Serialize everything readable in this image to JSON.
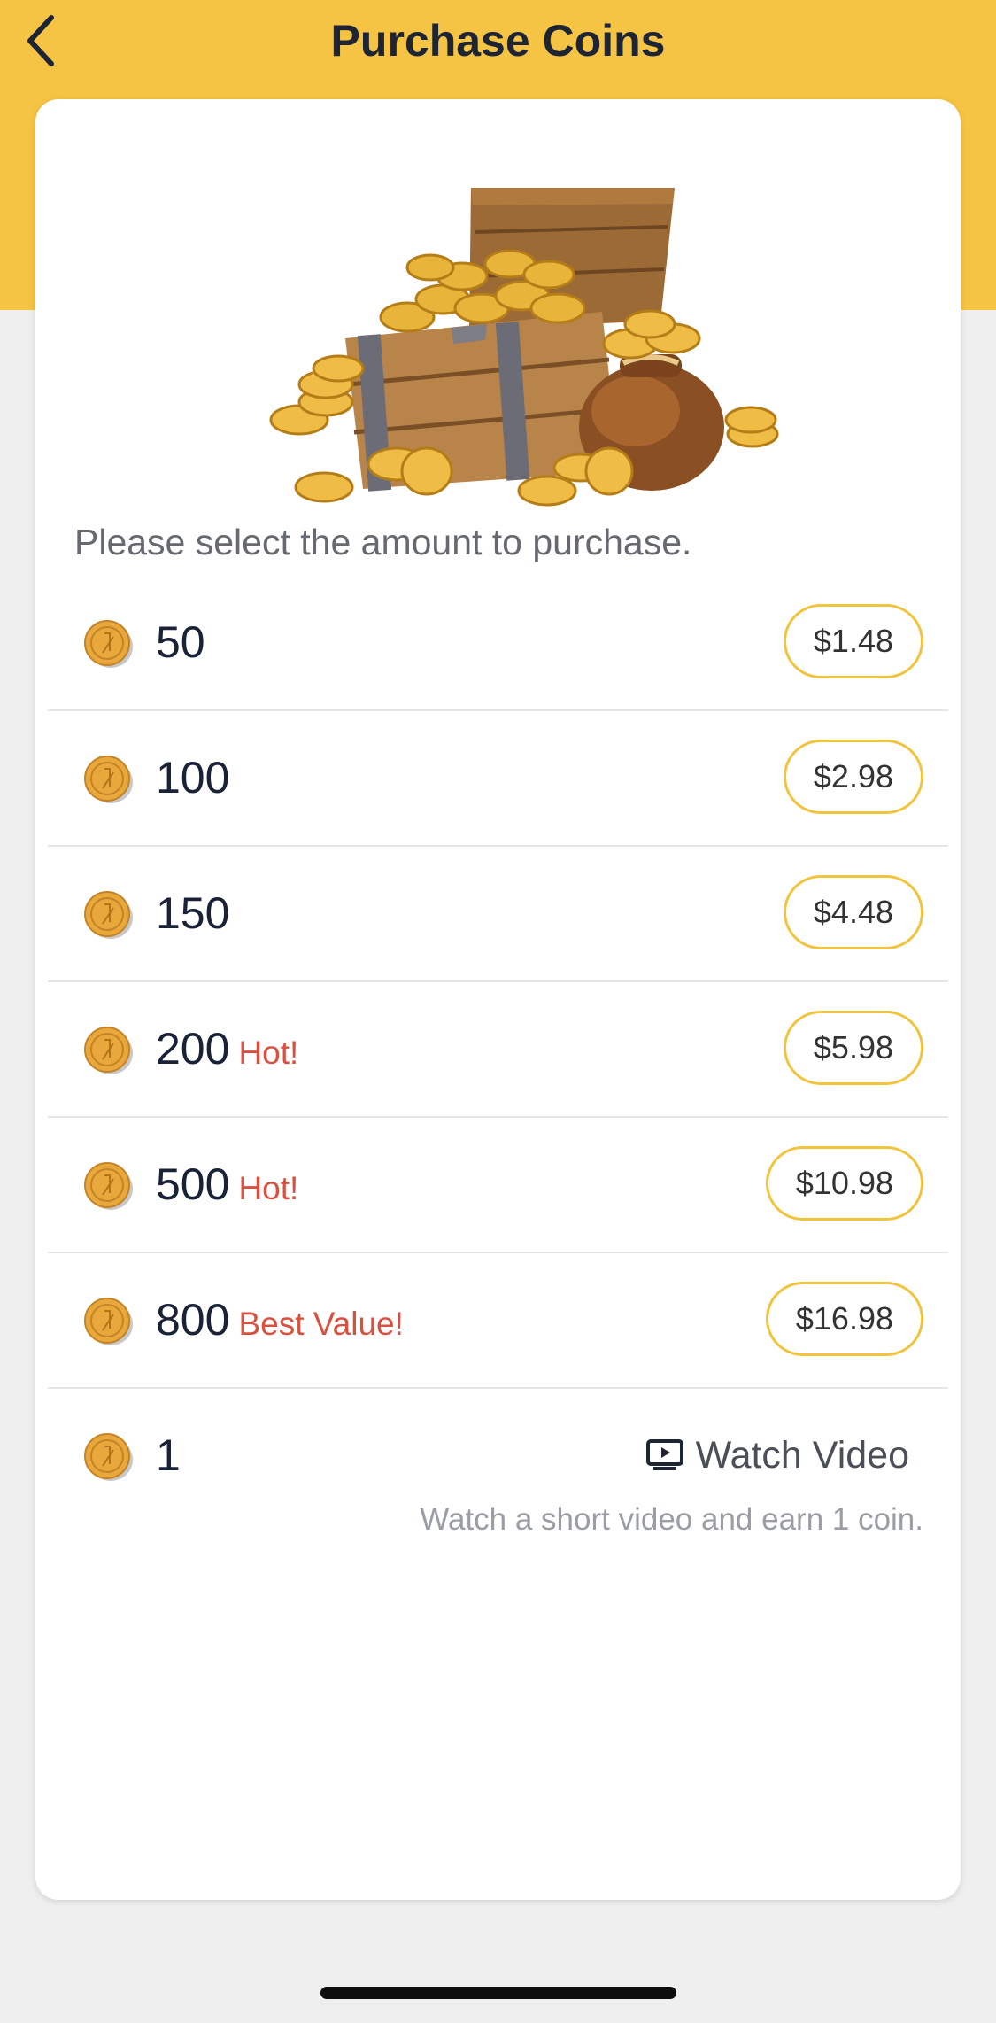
{
  "header": {
    "title": "Purchase Coins",
    "back_icon": "chevron-left-icon",
    "background": "#f6c444"
  },
  "hero": {
    "image": "treasure-chest-with-gold-coins"
  },
  "prompt": "Please select the amount to purchase.",
  "packages": [
    {
      "amount": "50",
      "tag": "",
      "price": "$1.48"
    },
    {
      "amount": "100",
      "tag": "",
      "price": "$2.98"
    },
    {
      "amount": "150",
      "tag": "",
      "price": "$4.48"
    },
    {
      "amount": "200",
      "tag": "Hot!",
      "price": "$5.98"
    },
    {
      "amount": "500",
      "tag": "Hot!",
      "price": "$10.98"
    },
    {
      "amount": "800",
      "tag": "Best Value!",
      "price": "$16.98"
    }
  ],
  "video_reward": {
    "amount": "1",
    "button_label": "Watch Video",
    "button_icon": "play-video-icon",
    "description": "Watch a short video and earn 1 coin."
  },
  "colors": {
    "accent": "#f6c444",
    "tag": "#d8513f",
    "text": "#1a2238"
  }
}
